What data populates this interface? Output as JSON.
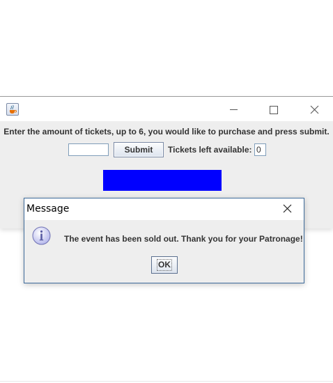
{
  "main_window": {
    "instructions": "Enter the amount of tickets, up to 6, you would like to purchase and press submit.",
    "quantity_value": "",
    "submit_label": "Submit",
    "tickets_left_label": "Tickets left available:",
    "tickets_left_value": "0",
    "blue_panel_color": "#0000ff",
    "icons": {
      "app": "java-cup-icon",
      "minimize": "minimize-icon",
      "maximize": "maximize-icon",
      "close": "close-icon"
    }
  },
  "dialog": {
    "title": "Message",
    "message": "The event has been sold out. Thank you for your Patronage!",
    "ok_label": "OK",
    "icons": {
      "info": "info-icon",
      "close": "close-icon"
    }
  }
}
